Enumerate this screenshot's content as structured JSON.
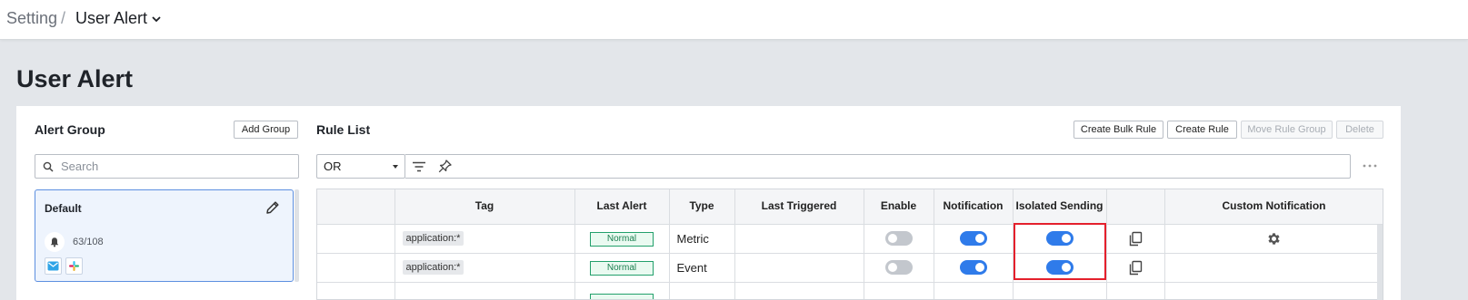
{
  "breadcrumb": {
    "root": "Setting",
    "separator": "/",
    "current": "User Alert"
  },
  "page": {
    "title": "User Alert"
  },
  "alert_group": {
    "title": "Alert Group",
    "add_button": "Add Group",
    "search_placeholder": "Search",
    "groups": [
      {
        "name": "Default",
        "count": "63/108",
        "channels": [
          "email-icon",
          "slack-icon"
        ]
      }
    ]
  },
  "rule_list": {
    "title": "Rule List",
    "buttons": {
      "create_bulk": "Create Bulk Rule",
      "create_rule": "Create Rule",
      "move_group": "Move Rule Group",
      "delete": "Delete"
    },
    "operator": "OR",
    "columns": {
      "tag": "Tag",
      "last_alert": "Last Alert",
      "type": "Type",
      "last_triggered": "Last Triggered",
      "enable": "Enable",
      "notification": "Notification",
      "isolated": "Isolated Sending",
      "custom": "Custom Notification"
    },
    "rows": [
      {
        "tag": "application:*",
        "last_alert": "Normal",
        "type": "Metric",
        "last_triggered": "",
        "enable": false,
        "notification": true,
        "isolated": true,
        "custom": "gear-icon"
      },
      {
        "tag": "application:*",
        "last_alert": "Normal",
        "type": "Event",
        "last_triggered": "",
        "enable": false,
        "notification": true,
        "isolated": true,
        "custom": ""
      }
    ]
  },
  "colors": {
    "accent": "#2f7bea",
    "status_ok": "#22a06b",
    "highlight": "#e4202c"
  }
}
